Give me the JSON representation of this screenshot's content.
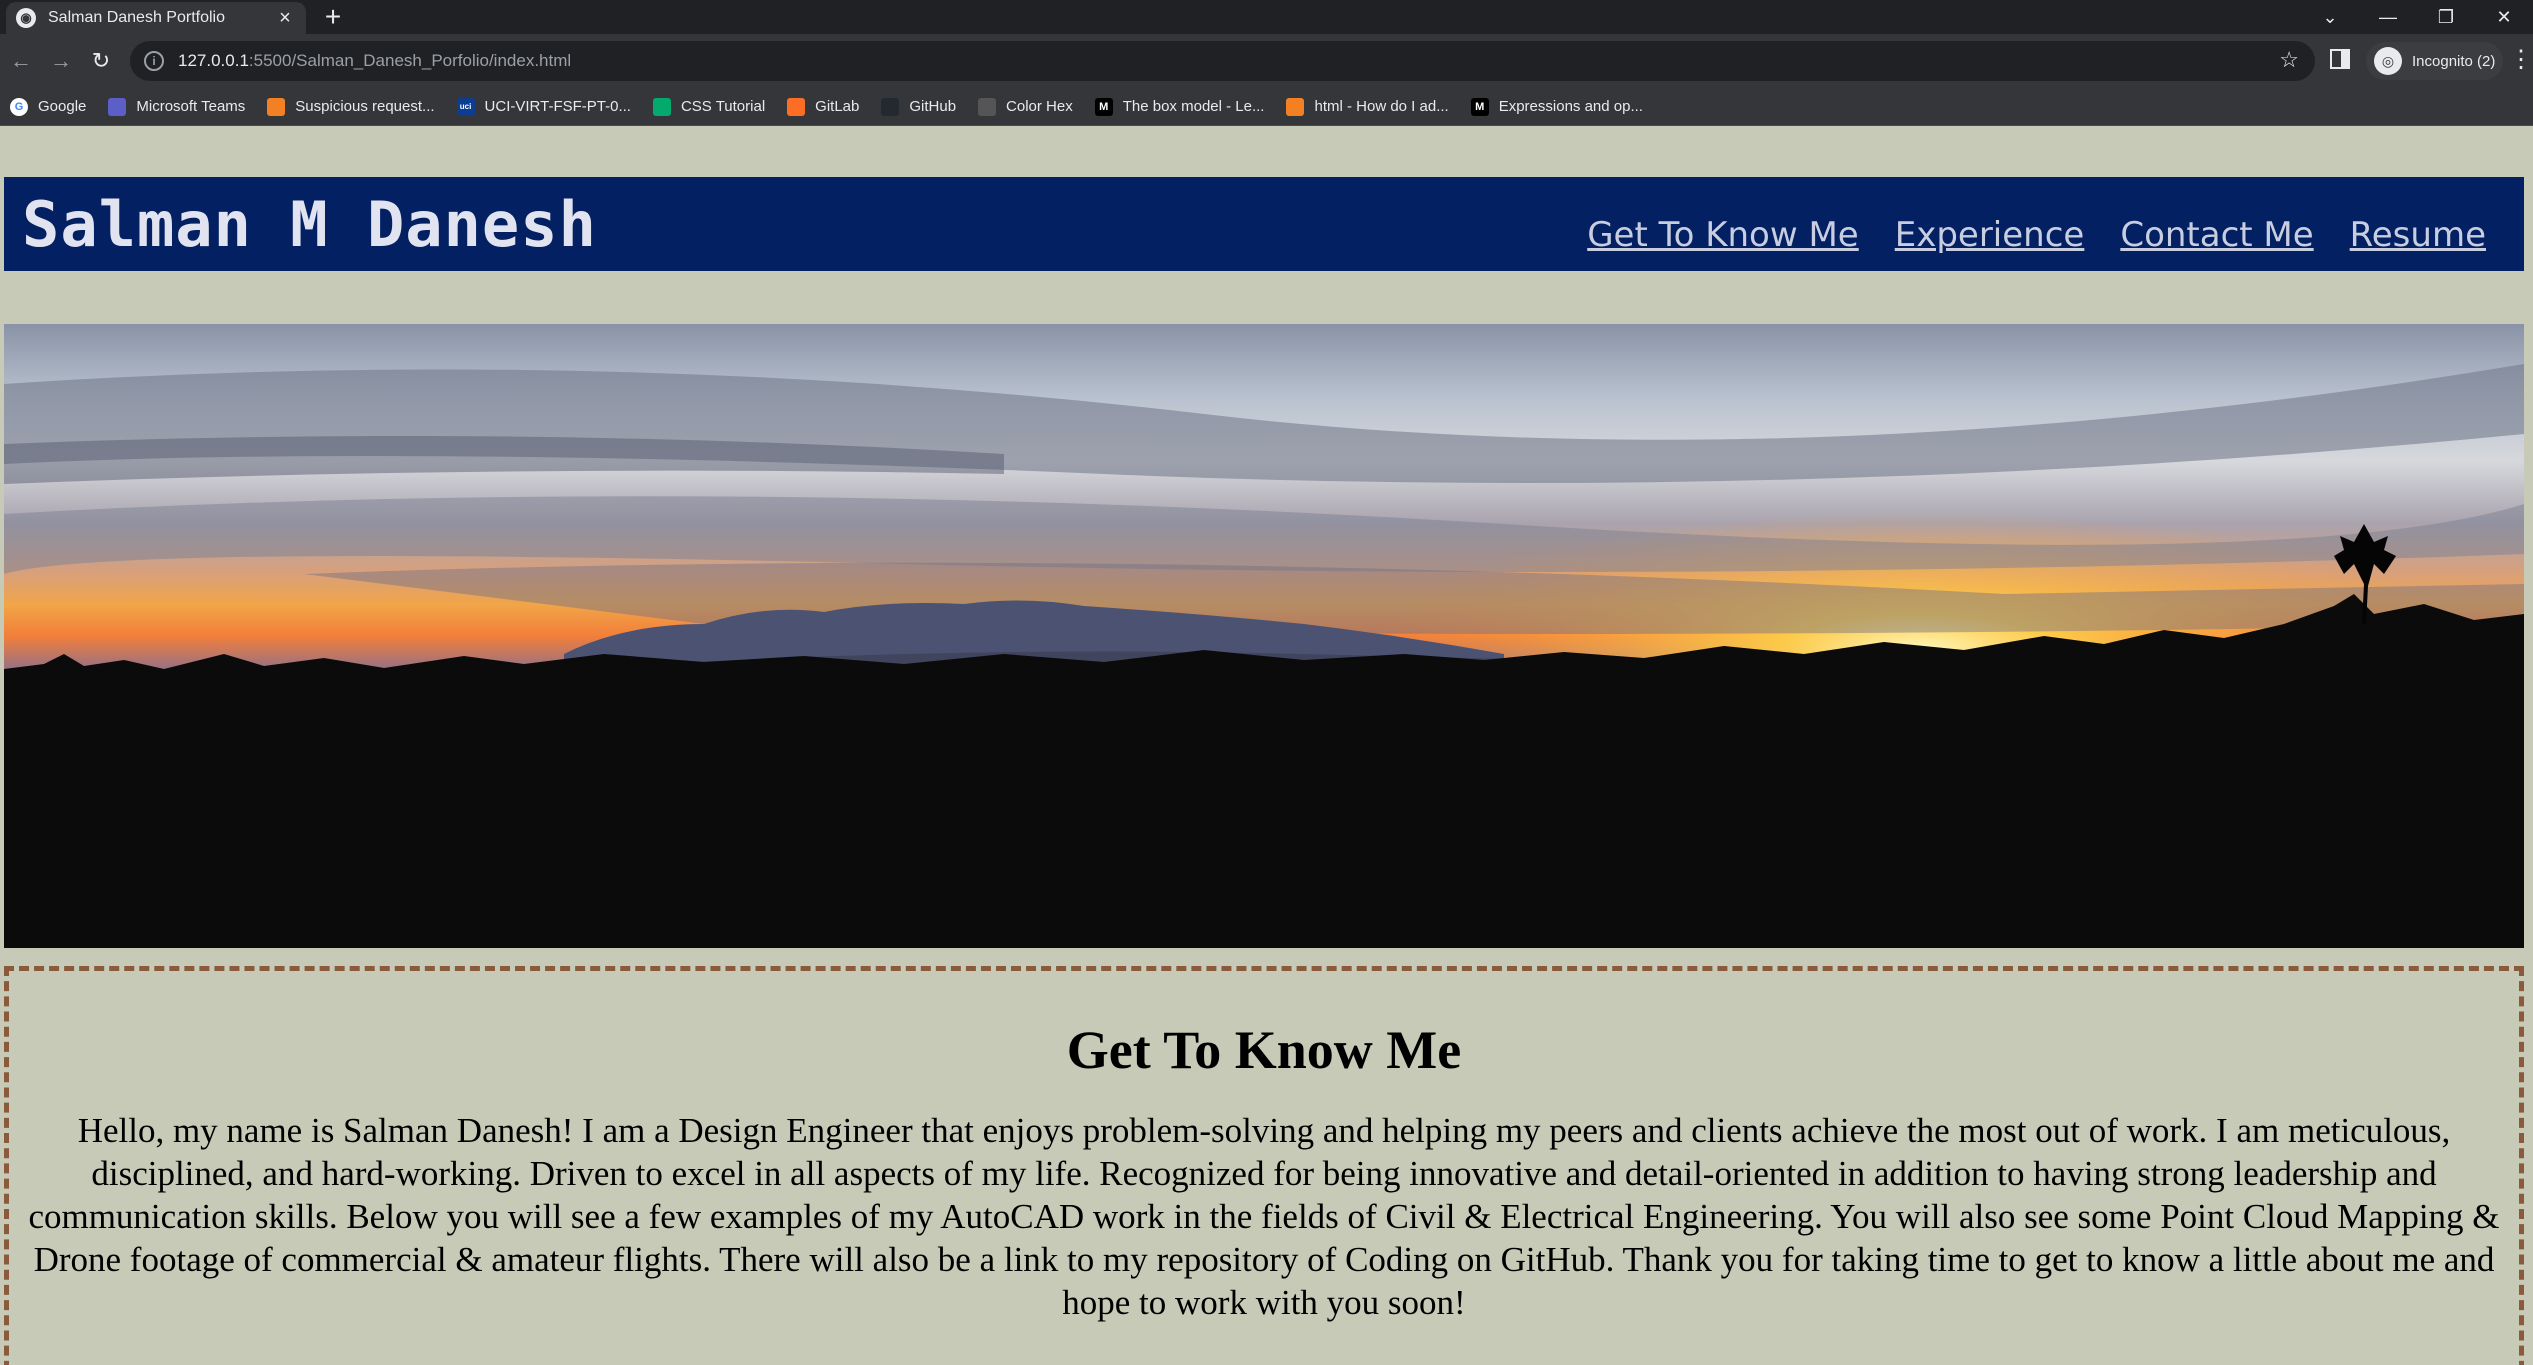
{
  "browser": {
    "tab_title": "Salman Danesh Portfolio",
    "url_host": "127.0.0.1",
    "url_path": ":5500/Salman_Danesh_Porfolio/index.html",
    "profile_label": "Incognito (2)",
    "bookmarks": [
      {
        "label": "Google",
        "icon": "google-icon",
        "color": "#ffffff"
      },
      {
        "label": "Microsoft Teams",
        "icon": "teams-icon",
        "color": "#5b5fc7"
      },
      {
        "label": "Suspicious request...",
        "icon": "stackoverflow-icon",
        "color": "#f48024"
      },
      {
        "label": "UCI-VIRT-FSF-PT-0...",
        "icon": "uci-icon",
        "color": "#0b3d91"
      },
      {
        "label": "CSS Tutorial",
        "icon": "w3schools-icon",
        "color": "#04aa6d"
      },
      {
        "label": "GitLab",
        "icon": "gitlab-icon",
        "color": "#fc6d26"
      },
      {
        "label": "GitHub",
        "icon": "github-icon",
        "color": "#24292f"
      },
      {
        "label": "Color Hex",
        "icon": "colorhex-icon",
        "color": "#555555"
      },
      {
        "label": "The box model - Le...",
        "icon": "mdn-icon",
        "color": "#000000"
      },
      {
        "label": "html - How do I ad...",
        "icon": "stackoverflow-icon",
        "color": "#f48024"
      },
      {
        "label": "Expressions and op...",
        "icon": "mdn-icon",
        "color": "#000000"
      }
    ]
  },
  "site": {
    "name": "Salman M Danesh",
    "nav": [
      "Get To Know Me",
      "Experience",
      "Contact Me",
      "Resume"
    ],
    "colors": {
      "header": "#022062",
      "background": "#c6cab6",
      "border": "#8b5a3c"
    }
  },
  "hero": {
    "description": "sunset-mountain-panorama"
  },
  "about": {
    "title": "Get To Know Me",
    "text": "Hello, my name is Salman Danesh! I am a Design Engineer that enjoys problem-solving and helping my peers and clients achieve the most out of work. I am meticulous, disciplined, and hard-working. Driven to excel in all aspects of my life. Recognized for being innovative and detail-oriented in addition to having strong leadership and communication skills. Below you will see a few examples of my AutoCAD work in the fields of Civil & Electrical Engineering. You will also see some Point Cloud Mapping & Drone footage of commercial & amateur flights. There will also be a link to my repository of Coding on GitHub. Thank you for taking time to get to know a little about me and hope to work with you soon!"
  }
}
